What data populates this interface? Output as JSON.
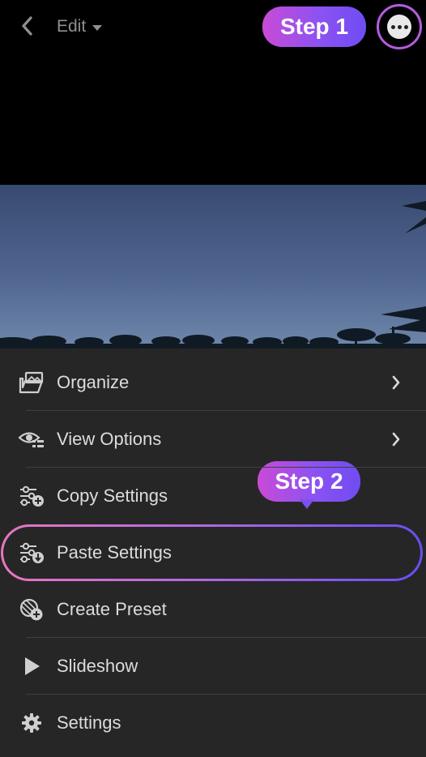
{
  "header": {
    "edit_label": "Edit",
    "step1_label": "Step 1"
  },
  "menu": {
    "items": [
      {
        "label": "Organize",
        "icon": "photos-folder-icon",
        "has_chevron": true
      },
      {
        "label": "View Options",
        "icon": "eye-icon",
        "has_chevron": true
      },
      {
        "label": "Copy Settings",
        "icon": "copy-settings-icon",
        "has_chevron": false
      },
      {
        "label": "Paste Settings",
        "icon": "paste-settings-icon",
        "has_chevron": false
      },
      {
        "label": "Create Preset",
        "icon": "create-preset-icon",
        "has_chevron": false
      },
      {
        "label": "Slideshow",
        "icon": "play-icon",
        "has_chevron": false
      },
      {
        "label": "Settings",
        "icon": "gear-icon",
        "has_chevron": false
      }
    ],
    "step2_label": "Step 2"
  },
  "colors": {
    "background": "#262626",
    "topbar": "#000000",
    "accent_pink": "#e776c0",
    "accent_purple": "#6a4ef0",
    "text": "#dcdcdc"
  }
}
